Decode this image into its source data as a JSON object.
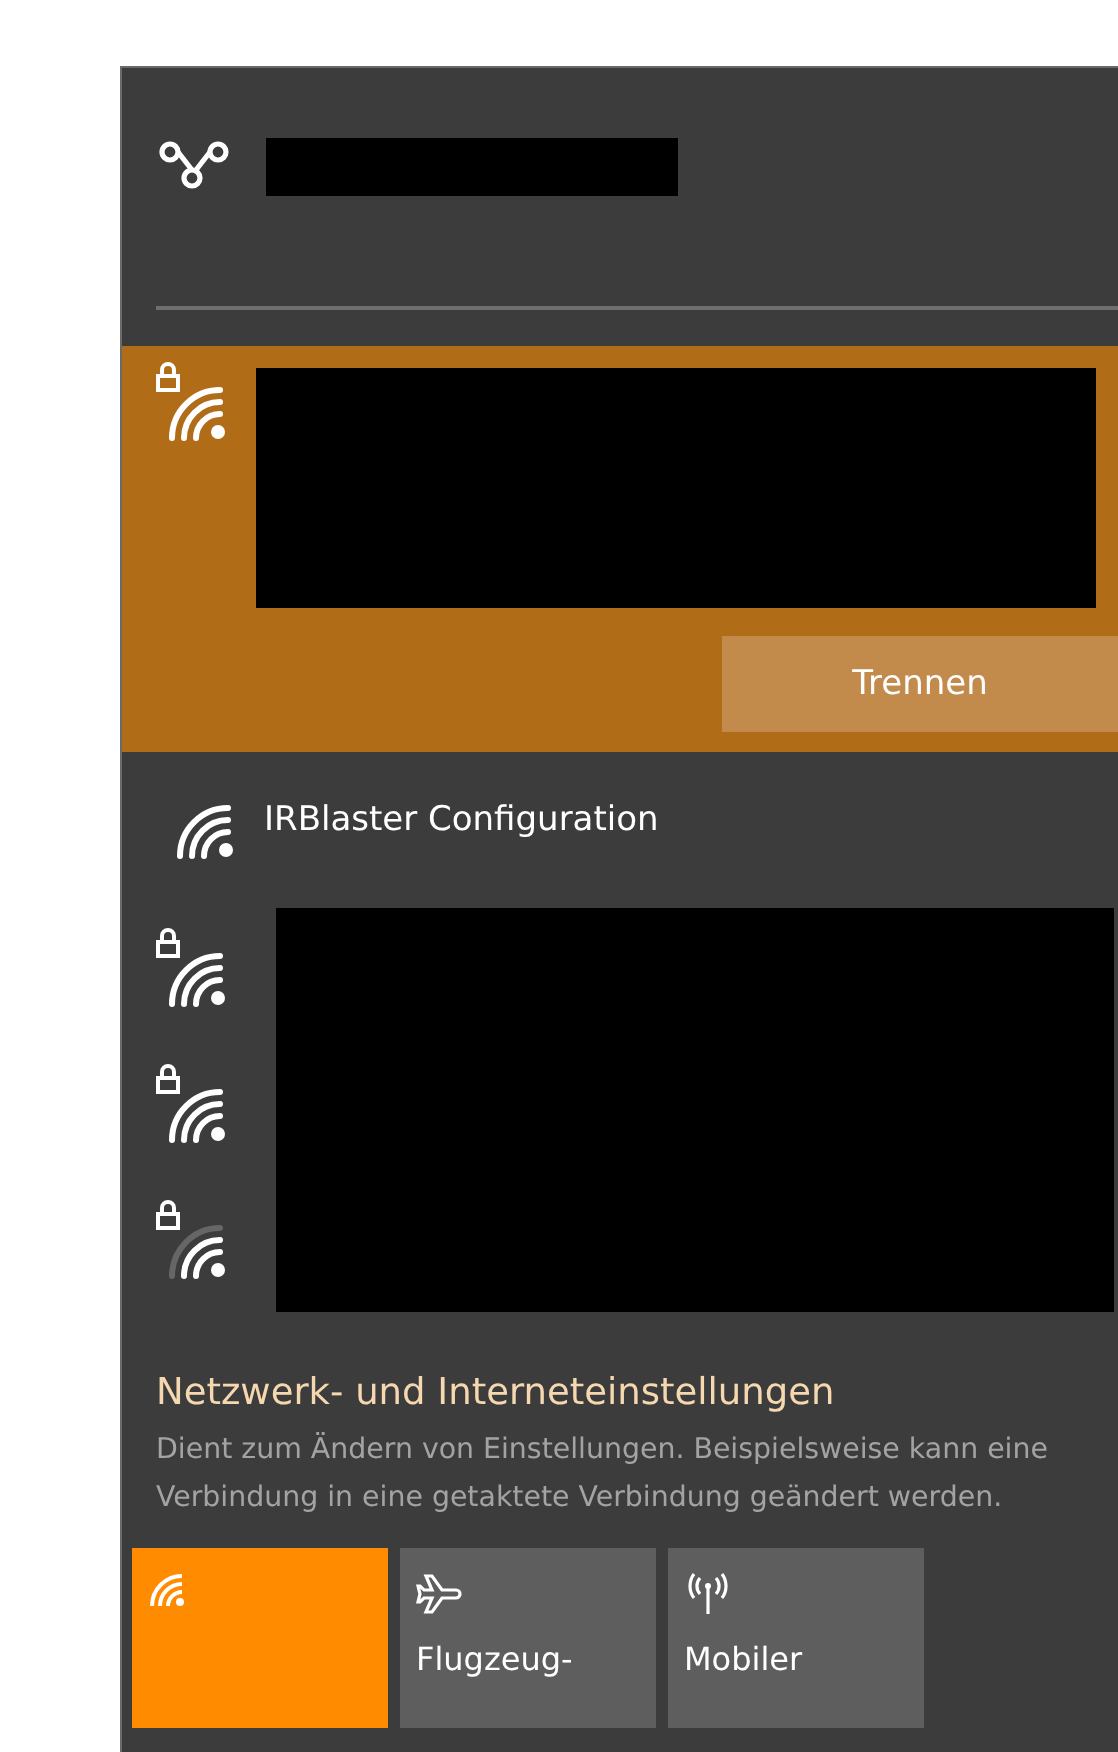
{
  "top_connection": {
    "kind": "redacted"
  },
  "networks": [
    {
      "secured": true,
      "weak_signal": false,
      "selected": true,
      "action": "Trennen"
    },
    {
      "name": "IRBlaster Configuration",
      "secured": false,
      "weak_signal": false,
      "selected": false
    },
    {
      "secured": true,
      "weak_signal": false,
      "selected": false
    },
    {
      "secured": true,
      "weak_signal": false,
      "selected": false
    },
    {
      "secured": true,
      "weak_signal": true,
      "selected": false
    }
  ],
  "settings": {
    "link": "Netzwerk- und Interneteinstellungen",
    "description": "Dient zum Ändern von Einstellungen. Beispielsweise kann eine Verbindung in eine getaktete Verbindung geändert werden."
  },
  "quick_actions": [
    {
      "kind": "wifi",
      "on": true
    },
    {
      "kind": "airplane",
      "label": "Flugzeug-",
      "on": false
    },
    {
      "kind": "mobile",
      "label": "Mobiler",
      "on": false
    }
  ]
}
